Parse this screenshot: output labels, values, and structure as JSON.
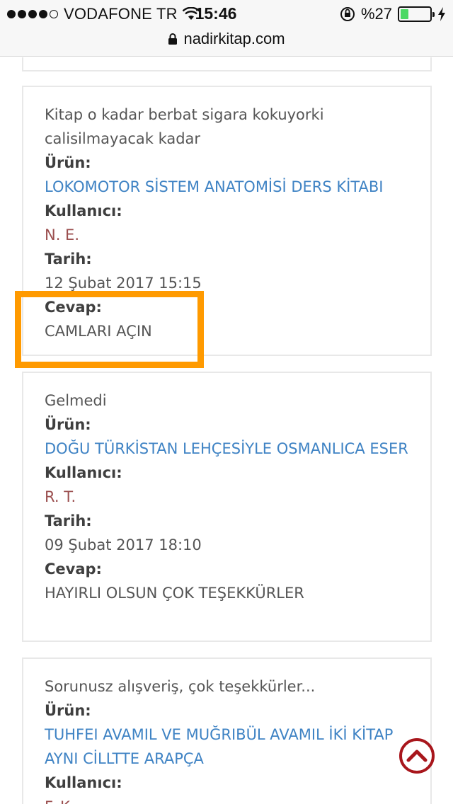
{
  "status": {
    "carrier": "VODAFONE TR",
    "time": "15:46",
    "battery_text": "%27",
    "battery_level": 0.27,
    "battery_color": "#4cd964"
  },
  "browser": {
    "url": "nadirkitap.com"
  },
  "labels": {
    "product": "Ürün:",
    "user": "Kullanıcı:",
    "date": "Tarih:",
    "answer": "Cevap:"
  },
  "reviews": [
    {
      "comment": "Kitap o kadar berbat sigara kokuyorki calisilmayacak kadar",
      "product": "LOKOMOTOR SİSTEM ANATOMİSİ DERS KİTABI",
      "user": "N. E.",
      "date": "12 Şubat 2017 15:15",
      "answer": "CAMLARI AÇIN"
    },
    {
      "comment": "Gelmedi",
      "product": "DOĞU TÜRKİSTAN LEHÇESİYLE OSMANLICA ESER",
      "user": "R. T.",
      "date": "09 Şubat 2017 18:10",
      "answer": "HAYIRLI OLSUN ÇOK TEŞEKKÜRLER"
    },
    {
      "comment": "Sorunusz alışveriş, çok teşekkürler...",
      "product": "TUHFEI AVAMIL VE MUĞRIBÜL AVAMIL İKİ KİTAP AYNI CİLLTTE ARAPÇA",
      "user": "F. K."
    }
  ],
  "colors": {
    "highlight": "#ff9a00",
    "product_link": "#3f83c4",
    "user_name": "#9b4f4f",
    "scroll_top": "#a8161c"
  },
  "icons": [
    "wifi-icon",
    "lock-icon",
    "alarm-icon",
    "charging-icon",
    "scroll-top-icon"
  ]
}
